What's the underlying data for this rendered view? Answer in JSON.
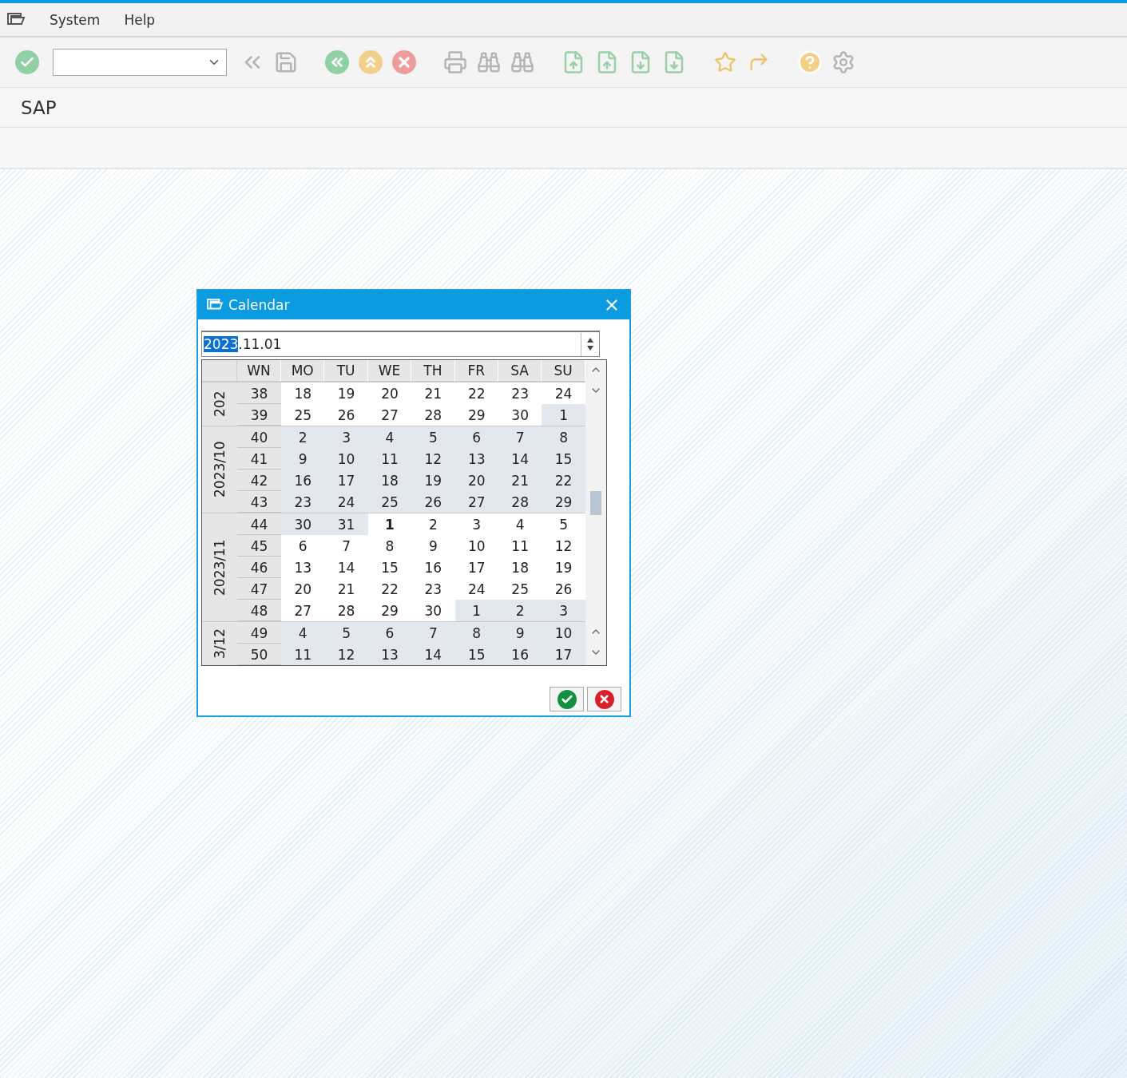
{
  "menu": [
    {
      "label": "System"
    },
    {
      "label": "Help"
    }
  ],
  "screen_title": "SAP",
  "dialog": {
    "title": "Calendar",
    "date_field": {
      "selected_text": "2023",
      "text_after": ".11.01"
    },
    "header": [
      "WN",
      "MO",
      "TU",
      "WE",
      "TH",
      "FR",
      "SA",
      "SU"
    ],
    "months": [
      {
        "label": "202",
        "weeks": [
          {
            "number": "38",
            "days": [
              {
                "text": "18",
                "shaded": false,
                "selected": false
              },
              {
                "text": "19",
                "shaded": false,
                "selected": false
              },
              {
                "text": "20",
                "shaded": false,
                "selected": false
              },
              {
                "text": "21",
                "shaded": false,
                "selected": false
              },
              {
                "text": "22",
                "shaded": false,
                "selected": false
              },
              {
                "text": "23",
                "shaded": false,
                "selected": false
              },
              {
                "text": "24",
                "shaded": false,
                "selected": false
              }
            ]
          },
          {
            "number": "39",
            "days": [
              {
                "text": "25",
                "shaded": false,
                "selected": false
              },
              {
                "text": "26",
                "shaded": false,
                "selected": false
              },
              {
                "text": "27",
                "shaded": false,
                "selected": false
              },
              {
                "text": "28",
                "shaded": false,
                "selected": false
              },
              {
                "text": "29",
                "shaded": false,
                "selected": false
              },
              {
                "text": "30",
                "shaded": false,
                "selected": false
              },
              {
                "text": "1",
                "shaded": true,
                "selected": false
              }
            ]
          }
        ]
      },
      {
        "label": "2023/10",
        "weeks": [
          {
            "number": "40",
            "days": [
              {
                "text": "2",
                "shaded": true,
                "selected": false
              },
              {
                "text": "3",
                "shaded": true,
                "selected": false
              },
              {
                "text": "4",
                "shaded": true,
                "selected": false
              },
              {
                "text": "5",
                "shaded": true,
                "selected": false
              },
              {
                "text": "6",
                "shaded": true,
                "selected": false
              },
              {
                "text": "7",
                "shaded": true,
                "selected": false
              },
              {
                "text": "8",
                "shaded": true,
                "selected": false
              }
            ]
          },
          {
            "number": "41",
            "days": [
              {
                "text": "9",
                "shaded": true,
                "selected": false
              },
              {
                "text": "10",
                "shaded": true,
                "selected": false
              },
              {
                "text": "11",
                "shaded": true,
                "selected": false
              },
              {
                "text": "12",
                "shaded": true,
                "selected": false
              },
              {
                "text": "13",
                "shaded": true,
                "selected": false
              },
              {
                "text": "14",
                "shaded": true,
                "selected": false
              },
              {
                "text": "15",
                "shaded": true,
                "selected": false
              }
            ]
          },
          {
            "number": "42",
            "days": [
              {
                "text": "16",
                "shaded": true,
                "selected": false
              },
              {
                "text": "17",
                "shaded": true,
                "selected": false
              },
              {
                "text": "18",
                "shaded": true,
                "selected": false
              },
              {
                "text": "19",
                "shaded": true,
                "selected": false
              },
              {
                "text": "20",
                "shaded": true,
                "selected": false
              },
              {
                "text": "21",
                "shaded": true,
                "selected": false
              },
              {
                "text": "22",
                "shaded": true,
                "selected": false
              }
            ]
          },
          {
            "number": "43",
            "days": [
              {
                "text": "23",
                "shaded": true,
                "selected": false
              },
              {
                "text": "24",
                "shaded": true,
                "selected": false
              },
              {
                "text": "25",
                "shaded": true,
                "selected": false
              },
              {
                "text": "26",
                "shaded": true,
                "selected": false
              },
              {
                "text": "27",
                "shaded": true,
                "selected": false
              },
              {
                "text": "28",
                "shaded": true,
                "selected": false
              },
              {
                "text": "29",
                "shaded": true,
                "selected": false
              }
            ]
          }
        ]
      },
      {
        "label": "2023/11",
        "weeks": [
          {
            "number": "44",
            "days": [
              {
                "text": "30",
                "shaded": true,
                "selected": false
              },
              {
                "text": "31",
                "shaded": true,
                "selected": false
              },
              {
                "text": "1",
                "shaded": false,
                "selected": true
              },
              {
                "text": "2",
                "shaded": false,
                "selected": false
              },
              {
                "text": "3",
                "shaded": false,
                "selected": false
              },
              {
                "text": "4",
                "shaded": false,
                "selected": false
              },
              {
                "text": "5",
                "shaded": false,
                "selected": false
              }
            ]
          },
          {
            "number": "45",
            "days": [
              {
                "text": "6",
                "shaded": false,
                "selected": false
              },
              {
                "text": "7",
                "shaded": false,
                "selected": false
              },
              {
                "text": "8",
                "shaded": false,
                "selected": false
              },
              {
                "text": "9",
                "shaded": false,
                "selected": false
              },
              {
                "text": "10",
                "shaded": false,
                "selected": false
              },
              {
                "text": "11",
                "shaded": false,
                "selected": false
              },
              {
                "text": "12",
                "shaded": false,
                "selected": false
              }
            ]
          },
          {
            "number": "46",
            "days": [
              {
                "text": "13",
                "shaded": false,
                "selected": false
              },
              {
                "text": "14",
                "shaded": false,
                "selected": false
              },
              {
                "text": "15",
                "shaded": false,
                "selected": false
              },
              {
                "text": "16",
                "shaded": false,
                "selected": false
              },
              {
                "text": "17",
                "shaded": false,
                "selected": false
              },
              {
                "text": "18",
                "shaded": false,
                "selected": false
              },
              {
                "text": "19",
                "shaded": false,
                "selected": false
              }
            ]
          },
          {
            "number": "47",
            "days": [
              {
                "text": "20",
                "shaded": false,
                "selected": false
              },
              {
                "text": "21",
                "shaded": false,
                "selected": false
              },
              {
                "text": "22",
                "shaded": false,
                "selected": false
              },
              {
                "text": "23",
                "shaded": false,
                "selected": false
              },
              {
                "text": "24",
                "shaded": false,
                "selected": false
              },
              {
                "text": "25",
                "shaded": false,
                "selected": false
              },
              {
                "text": "26",
                "shaded": false,
                "selected": false
              }
            ]
          },
          {
            "number": "48",
            "days": [
              {
                "text": "27",
                "shaded": false,
                "selected": false
              },
              {
                "text": "28",
                "shaded": false,
                "selected": false
              },
              {
                "text": "29",
                "shaded": false,
                "selected": false
              },
              {
                "text": "30",
                "shaded": false,
                "selected": false
              },
              {
                "text": "1",
                "shaded": true,
                "selected": false
              },
              {
                "text": "2",
                "shaded": true,
                "selected": false
              },
              {
                "text": "3",
                "shaded": true,
                "selected": false
              }
            ]
          }
        ]
      },
      {
        "label": "3/12",
        "weeks": [
          {
            "number": "49",
            "days": [
              {
                "text": "4",
                "shaded": true,
                "selected": false
              },
              {
                "text": "5",
                "shaded": true,
                "selected": false
              },
              {
                "text": "6",
                "shaded": true,
                "selected": false
              },
              {
                "text": "7",
                "shaded": true,
                "selected": false
              },
              {
                "text": "8",
                "shaded": true,
                "selected": false
              },
              {
                "text": "9",
                "shaded": true,
                "selected": false
              },
              {
                "text": "10",
                "shaded": true,
                "selected": false
              }
            ]
          },
          {
            "number": "50",
            "days": [
              {
                "text": "11",
                "shaded": true,
                "selected": false
              },
              {
                "text": "12",
                "shaded": true,
                "selected": false
              },
              {
                "text": "13",
                "shaded": true,
                "selected": false
              },
              {
                "text": "14",
                "shaded": true,
                "selected": false
              },
              {
                "text": "15",
                "shaded": true,
                "selected": false
              },
              {
                "text": "16",
                "shaded": true,
                "selected": false
              },
              {
                "text": "17",
                "shaded": true,
                "selected": false
              }
            ]
          }
        ]
      }
    ]
  }
}
